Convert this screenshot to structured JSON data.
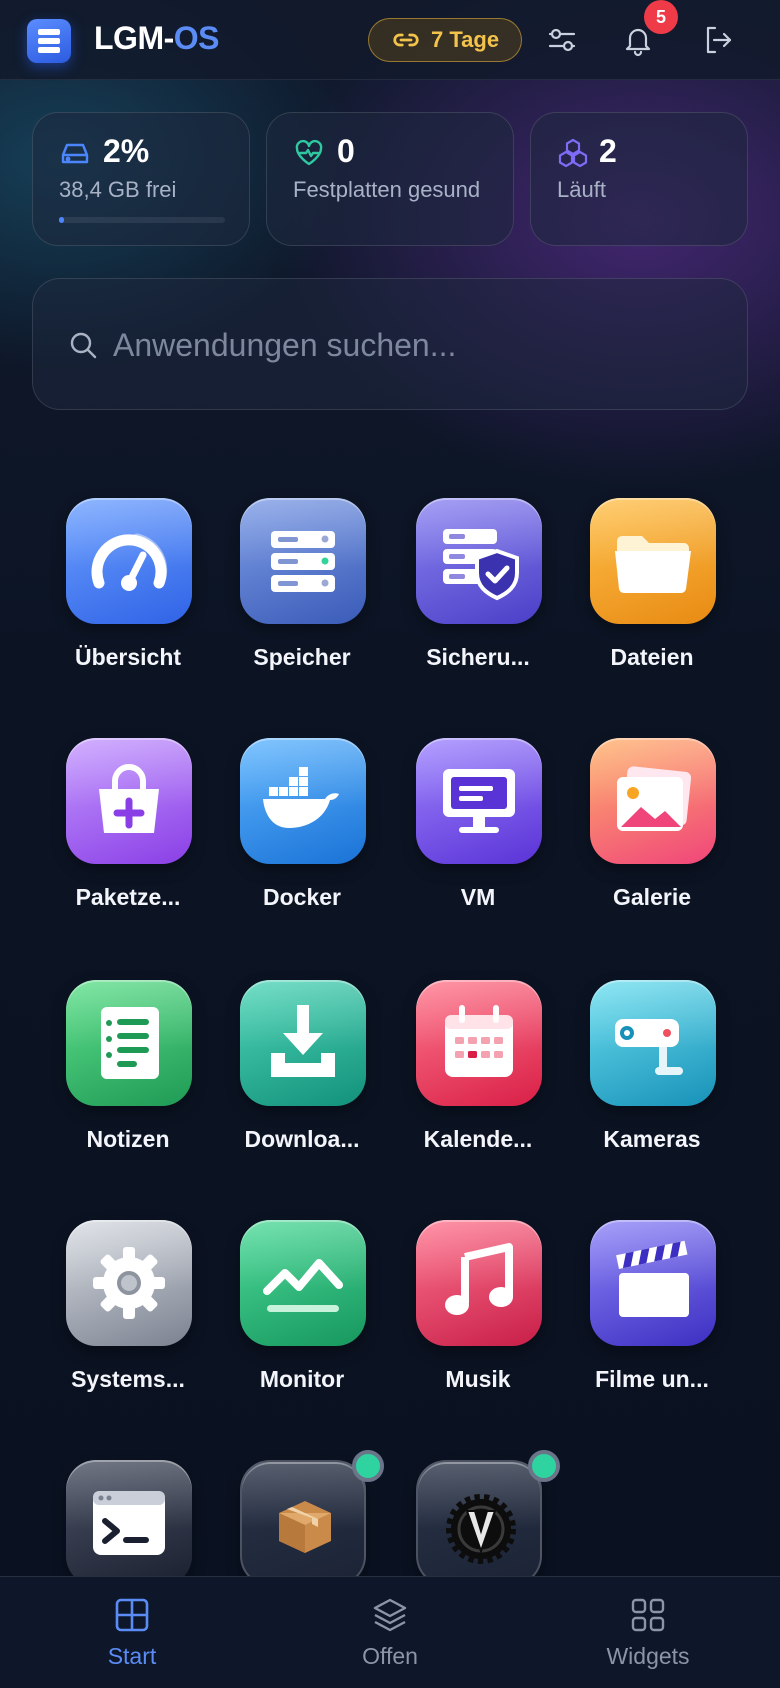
{
  "header": {
    "title_part1": "LGM-",
    "title_part2": "OS",
    "session_label": "7 Tage",
    "notification_count": "5",
    "icons": [
      "menu-icon",
      "link-icon",
      "sliders-icon",
      "bell-icon",
      "logout-icon"
    ]
  },
  "stats": {
    "storage": {
      "value": "2%",
      "label": "38,4 GB frei",
      "usage_fraction": 0.02
    },
    "disks": {
      "value": "0",
      "label": "Festplatten gesund"
    },
    "containers": {
      "value": "2",
      "label": "Läuft"
    }
  },
  "search": {
    "placeholder": "Anwendungen suchen..."
  },
  "apps": [
    {
      "label": "Übersicht",
      "icon": "dashboard-gauge-icon"
    },
    {
      "label": "Speicher",
      "icon": "storage-server-icon"
    },
    {
      "label": "Sicheru...",
      "icon": "backup-shield-icon"
    },
    {
      "label": "Dateien",
      "icon": "folder-icon"
    },
    {
      "label": "Paketze...",
      "icon": "package-bag-icon"
    },
    {
      "label": "Docker",
      "icon": "docker-whale-icon"
    },
    {
      "label": "VM",
      "icon": "monitor-icon"
    },
    {
      "label": "Galerie",
      "icon": "photo-gallery-icon"
    },
    {
      "label": "Notizen",
      "icon": "notes-icon"
    },
    {
      "label": "Downloa...",
      "icon": "download-icon"
    },
    {
      "label": "Kalende...",
      "icon": "calendar-icon"
    },
    {
      "label": "Kameras",
      "icon": "security-camera-icon"
    },
    {
      "label": "Systems...",
      "icon": "settings-gear-icon"
    },
    {
      "label": "Monitor",
      "icon": "activity-chart-icon"
    },
    {
      "label": "Musik",
      "icon": "music-note-icon"
    },
    {
      "label": "Filme un...",
      "icon": "clapperboard-icon"
    },
    {
      "label": "",
      "icon": "terminal-icon"
    },
    {
      "label": "",
      "icon": "package-box-icon",
      "running": true
    },
    {
      "label": "",
      "icon": "vaultwarden-gear-icon",
      "running": true
    }
  ],
  "bottom_nav": {
    "start": "Start",
    "open": "Offen",
    "widgets": "Widgets",
    "active": "Start"
  },
  "colors": {
    "accent": "#5b8cf5",
    "badge": "#ef3b48",
    "session_pill": "#f4c34b",
    "running_dot": "#2ed3a0"
  }
}
